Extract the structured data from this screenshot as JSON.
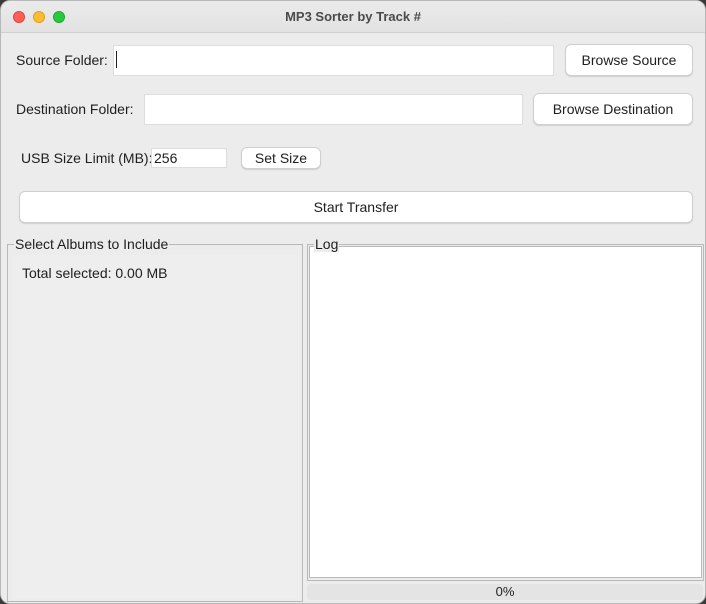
{
  "window": {
    "title": "MP3 Sorter by Track #"
  },
  "source": {
    "label": "Source Folder:",
    "value": "",
    "browse_label": "Browse Source"
  },
  "destination": {
    "label": "Destination Folder:",
    "value": "",
    "browse_label": "Browse Destination"
  },
  "usb": {
    "label": "USB Size Limit (MB):",
    "value": "256",
    "set_label": "Set Size"
  },
  "transfer": {
    "start_label": "Start Transfer"
  },
  "albums": {
    "title": "Select Albums to Include",
    "total_selected": "Total selected: 0.00 MB"
  },
  "log": {
    "title": "Log"
  },
  "progress": {
    "value": 0,
    "text": "0%"
  },
  "colors": {
    "close": "#fe5f57",
    "minimize": "#febc2e",
    "maximize": "#28c840"
  }
}
